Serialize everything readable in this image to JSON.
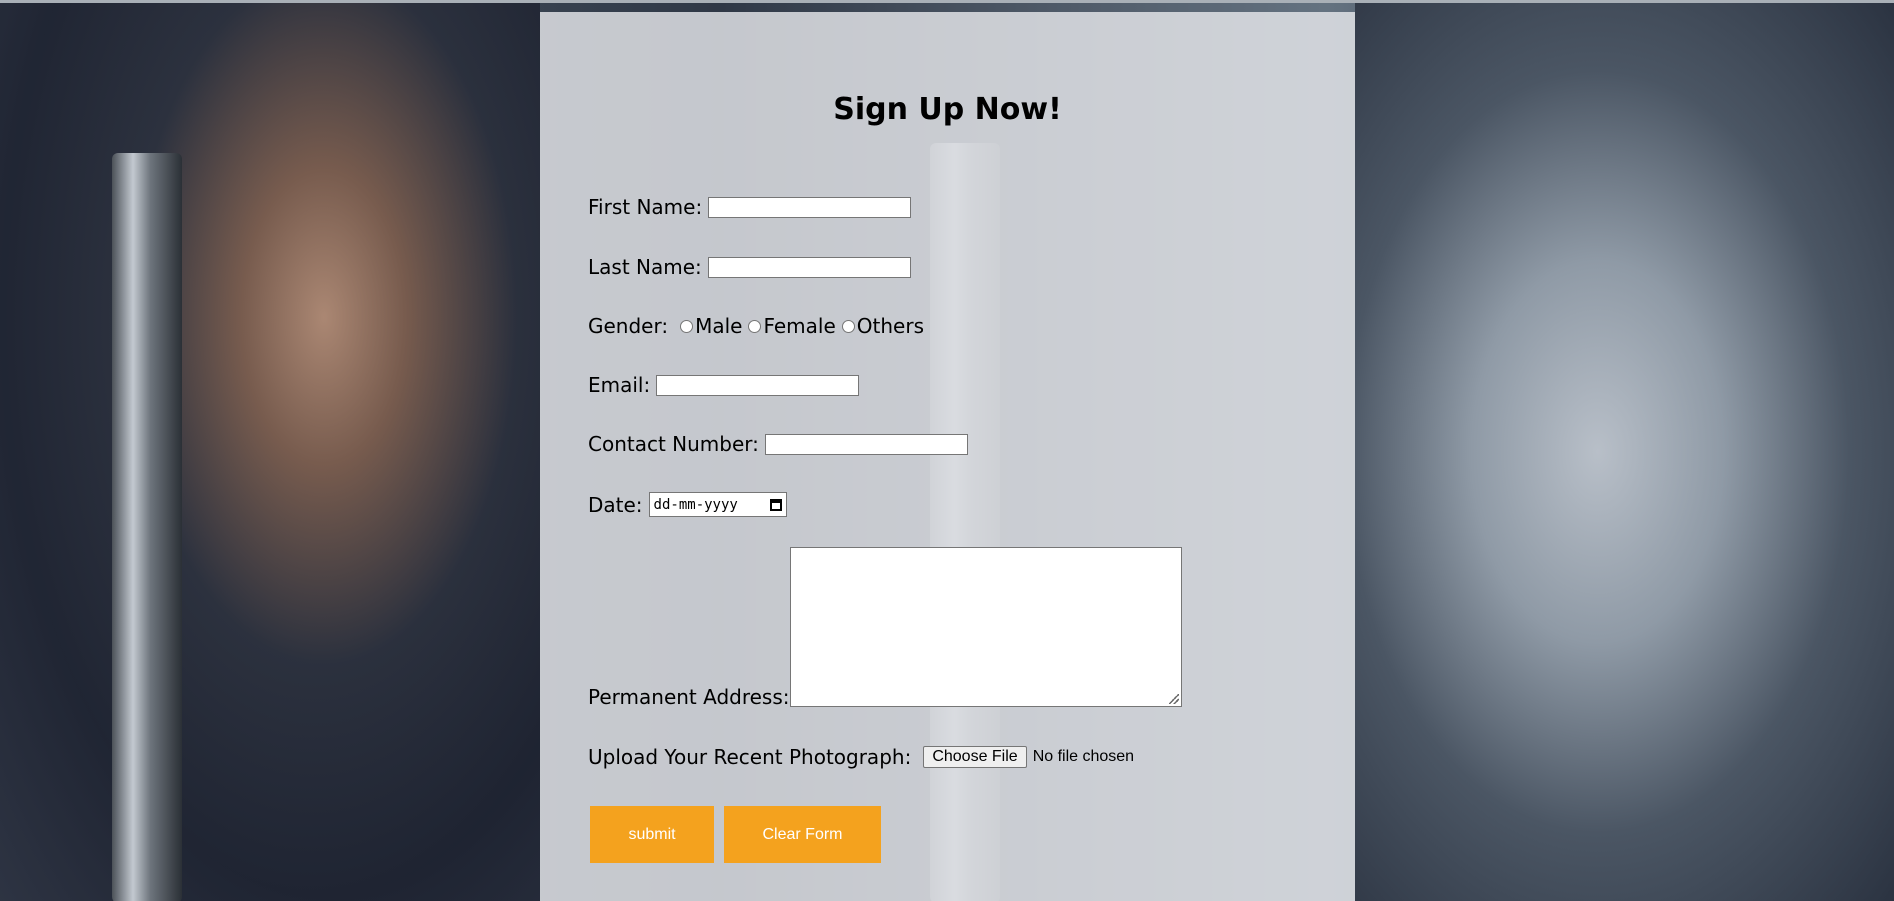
{
  "form": {
    "title": "Sign Up Now!",
    "first_name_label": "First Name:",
    "first_name_value": "",
    "last_name_label": "Last Name:",
    "last_name_value": "",
    "gender_label": "Gender:",
    "gender_options": [
      "Male",
      "Female",
      "Others"
    ],
    "email_label": "Email:",
    "email_value": "",
    "contact_label": "Contact Number:",
    "contact_value": "",
    "date_label": "Date:",
    "date_placeholder": "dd-mm-yyyy",
    "address_label": "Permanent Address:",
    "address_value": "",
    "upload_label": "Upload Your Recent Photograph:",
    "choose_file_label": "Choose File",
    "file_status": "No file chosen",
    "submit_label": "submit",
    "clear_label": "Clear Form"
  },
  "colors": {
    "accent": "#f4a21e",
    "panel": "#e6e8ec"
  }
}
